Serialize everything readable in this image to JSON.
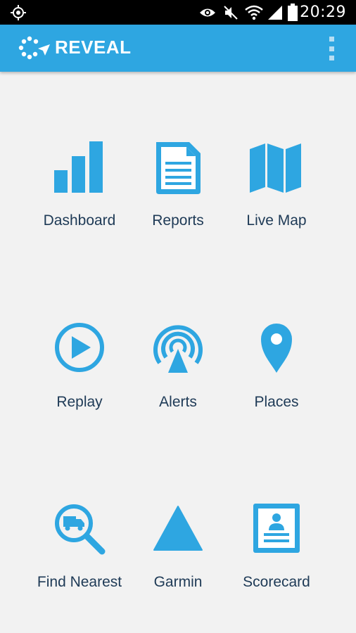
{
  "status_bar": {
    "time": "20:29",
    "icons": [
      "gps-icon",
      "eye-icon",
      "mute-icon",
      "wifi-icon",
      "signal-icon",
      "battery-icon"
    ]
  },
  "app_bar": {
    "title": "REVEAL",
    "logo_icon": "reveal-logo-icon",
    "menu_icon": "overflow-menu-icon"
  },
  "colors": {
    "accent": "#2ea6e1",
    "label": "#1e3a56",
    "background": "#f2f2f2"
  },
  "menu": {
    "items": [
      {
        "label": "Dashboard",
        "icon": "bar-chart-icon"
      },
      {
        "label": "Reports",
        "icon": "document-icon"
      },
      {
        "label": "Live Map",
        "icon": "map-icon"
      },
      {
        "label": "Replay",
        "icon": "play-icon"
      },
      {
        "label": "Alerts",
        "icon": "alert-broadcast-icon"
      },
      {
        "label": "Places",
        "icon": "location-pin-icon"
      },
      {
        "label": "Find Nearest",
        "icon": "find-truck-icon"
      },
      {
        "label": "Garmin",
        "icon": "triangle-icon"
      },
      {
        "label": "Scorecard",
        "icon": "scorecard-icon"
      }
    ]
  }
}
